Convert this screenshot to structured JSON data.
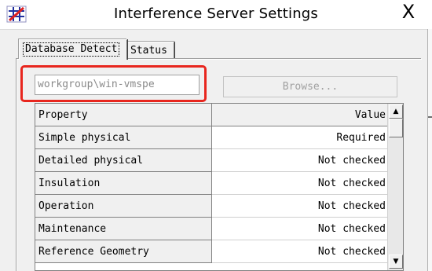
{
  "window": {
    "title": "Interference Server Settings",
    "close_label": "X"
  },
  "tabs": [
    {
      "label": "Database Detect",
      "selected": true
    },
    {
      "label": "Status",
      "selected": false
    }
  ],
  "database": {
    "server_path": "workgroup\\win-vmspe",
    "browse_label": "Browse..."
  },
  "grid": {
    "columns": [
      "Property",
      "Value"
    ],
    "rows": [
      {
        "property": "Simple physical",
        "value": "Required"
      },
      {
        "property": "Detailed physical",
        "value": "Not checked"
      },
      {
        "property": "Insulation",
        "value": "Not checked"
      },
      {
        "property": "Operation",
        "value": "Not checked"
      },
      {
        "property": "Maintenance",
        "value": "Not checked"
      },
      {
        "property": "Reference Geometry",
        "value": "Not checked"
      }
    ]
  },
  "colors": {
    "highlight": "#e8261e",
    "window_bg": "#f0f0f0",
    "disabled_text": "#a0a0a0"
  },
  "icons": {
    "app": "interference-app-icon",
    "close": "close-icon",
    "scroll_up": "scroll-up-arrow-icon",
    "scroll_down": "scroll-down-arrow-icon"
  }
}
